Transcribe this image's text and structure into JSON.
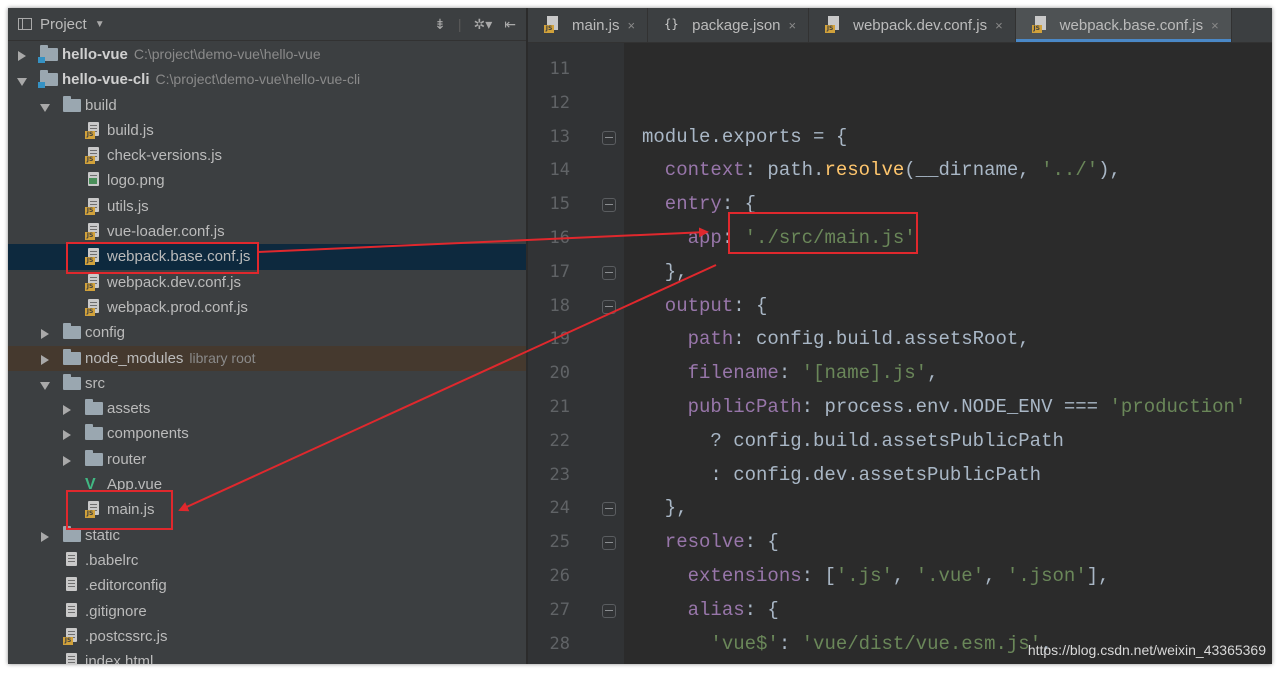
{
  "project_panel": {
    "title": "Project",
    "tree": [
      {
        "label": "hello-vue",
        "path": "C:\\project\\demo-vue\\hello-vue",
        "kind": "module",
        "depth": 0,
        "expanded": false
      },
      {
        "label": "hello-vue-cli",
        "path": "C:\\project\\demo-vue\\hello-vue-cli",
        "kind": "module",
        "depth": 0,
        "expanded": true
      },
      {
        "label": "build",
        "kind": "folder",
        "depth": 1,
        "expanded": true
      },
      {
        "label": "build.js",
        "kind": "js",
        "depth": 2
      },
      {
        "label": "check-versions.js",
        "kind": "js",
        "depth": 2
      },
      {
        "label": "logo.png",
        "kind": "image",
        "depth": 2
      },
      {
        "label": "utils.js",
        "kind": "js",
        "depth": 2
      },
      {
        "label": "vue-loader.conf.js",
        "kind": "js",
        "depth": 2
      },
      {
        "label": "webpack.base.conf.js",
        "kind": "js",
        "depth": 2,
        "selected": true
      },
      {
        "label": "webpack.dev.conf.js",
        "kind": "js",
        "depth": 2
      },
      {
        "label": "webpack.prod.conf.js",
        "kind": "js",
        "depth": 2
      },
      {
        "label": "config",
        "kind": "folder",
        "depth": 1,
        "expanded": false
      },
      {
        "label": "node_modules",
        "suffix": "library root",
        "kind": "folder",
        "depth": 1,
        "expanded": false,
        "excluded": true
      },
      {
        "label": "src",
        "kind": "folder",
        "depth": 1,
        "expanded": true
      },
      {
        "label": "assets",
        "kind": "folder",
        "depth": 2,
        "expanded": false
      },
      {
        "label": "components",
        "kind": "folder",
        "depth": 2,
        "expanded": false
      },
      {
        "label": "router",
        "kind": "folder",
        "depth": 2,
        "expanded": false
      },
      {
        "label": "App.vue",
        "kind": "vue",
        "depth": 2
      },
      {
        "label": "main.js",
        "kind": "js",
        "depth": 2
      },
      {
        "label": "static",
        "kind": "folder",
        "depth": 1,
        "expanded": false
      },
      {
        "label": ".babelrc",
        "kind": "config",
        "depth": 1
      },
      {
        "label": ".editorconfig",
        "kind": "text",
        "depth": 1
      },
      {
        "label": ".gitignore",
        "kind": "text",
        "depth": 1
      },
      {
        "label": ".postcssrc.js",
        "kind": "js",
        "depth": 1
      },
      {
        "label": "index.html",
        "kind": "html",
        "depth": 1
      }
    ]
  },
  "editor": {
    "tabs": [
      {
        "label": "main.js",
        "icon": "js-file-icon",
        "active": false
      },
      {
        "label": "package.json",
        "icon": "json-file-icon",
        "active": false
      },
      {
        "label": "webpack.dev.conf.js",
        "icon": "js-file-icon",
        "active": false
      },
      {
        "label": "webpack.base.conf.js",
        "icon": "js-file-icon",
        "active": true
      }
    ],
    "close_glyph": "×",
    "lines": [
      {
        "num": "11",
        "tokens": []
      },
      {
        "num": "12",
        "tokens": []
      },
      {
        "num": "13",
        "fold": true,
        "tokens": [
          [
            "module",
            "plain"
          ],
          [
            ".",
            "plain"
          ],
          [
            "exports",
            "plain"
          ],
          [
            " = {",
            "plain"
          ]
        ]
      },
      {
        "num": "14",
        "tokens": [
          [
            "  context",
            "prop"
          ],
          [
            ": path.",
            "plain"
          ],
          [
            "resolve",
            "fn"
          ],
          [
            "(__dirname, ",
            "plain"
          ],
          [
            "'../'",
            "str"
          ],
          [
            "),",
            "plain"
          ]
        ]
      },
      {
        "num": "15",
        "fold": true,
        "tokens": [
          [
            "  entry",
            "prop"
          ],
          [
            ": {",
            "plain"
          ]
        ]
      },
      {
        "num": "16",
        "tokens": [
          [
            "    app",
            "prop"
          ],
          [
            ": ",
            "plain"
          ],
          [
            "'./src/main.js'",
            "str"
          ]
        ]
      },
      {
        "num": "17",
        "fold": true,
        "tokens": [
          [
            "  },",
            "plain"
          ]
        ]
      },
      {
        "num": "18",
        "fold": true,
        "tokens": [
          [
            "  output",
            "prop"
          ],
          [
            ": {",
            "plain"
          ]
        ]
      },
      {
        "num": "19",
        "tokens": [
          [
            "    path",
            "prop"
          ],
          [
            ": config.build.assetsRoot,",
            "plain"
          ]
        ]
      },
      {
        "num": "20",
        "tokens": [
          [
            "    filename",
            "prop"
          ],
          [
            ": ",
            "plain"
          ],
          [
            "'[name].js'",
            "str"
          ],
          [
            ",",
            "plain"
          ]
        ]
      },
      {
        "num": "21",
        "tokens": [
          [
            "    publicPath",
            "prop"
          ],
          [
            ": process.env.NODE_ENV === ",
            "plain"
          ],
          [
            "'production'",
            "str"
          ]
        ]
      },
      {
        "num": "22",
        "tokens": [
          [
            "      ? config.build.assetsPublicPath",
            "plain"
          ]
        ]
      },
      {
        "num": "23",
        "tokens": [
          [
            "      : config.dev.assetsPublicPath",
            "plain"
          ]
        ]
      },
      {
        "num": "24",
        "fold": true,
        "tokens": [
          [
            "  },",
            "plain"
          ]
        ]
      },
      {
        "num": "25",
        "fold": true,
        "tokens": [
          [
            "  resolve",
            "prop"
          ],
          [
            ": {",
            "plain"
          ]
        ]
      },
      {
        "num": "26",
        "tokens": [
          [
            "    extensions",
            "prop"
          ],
          [
            ": [",
            "plain"
          ],
          [
            "'.js'",
            "str"
          ],
          [
            ", ",
            "plain"
          ],
          [
            "'.vue'",
            "str"
          ],
          [
            ", ",
            "plain"
          ],
          [
            "'.json'",
            "str"
          ],
          [
            "],",
            "plain"
          ]
        ]
      },
      {
        "num": "27",
        "fold": true,
        "tokens": [
          [
            "    alias",
            "prop"
          ],
          [
            ": {",
            "plain"
          ]
        ]
      },
      {
        "num": "28",
        "tokens": [
          [
            "      ",
            "plain"
          ],
          [
            "'vue$'",
            "str"
          ],
          [
            ": ",
            "plain"
          ],
          [
            "'vue/dist/vue.esm.js'",
            "str"
          ],
          [
            ",",
            "plain"
          ]
        ]
      }
    ]
  },
  "watermark": "https://blog.csdn.net/weixin_43365369",
  "colors": {
    "annotation": "#e0282d",
    "keyword": "#cc7832",
    "property": "#9876aa",
    "string": "#6a8759",
    "function": "#ffc66d"
  }
}
